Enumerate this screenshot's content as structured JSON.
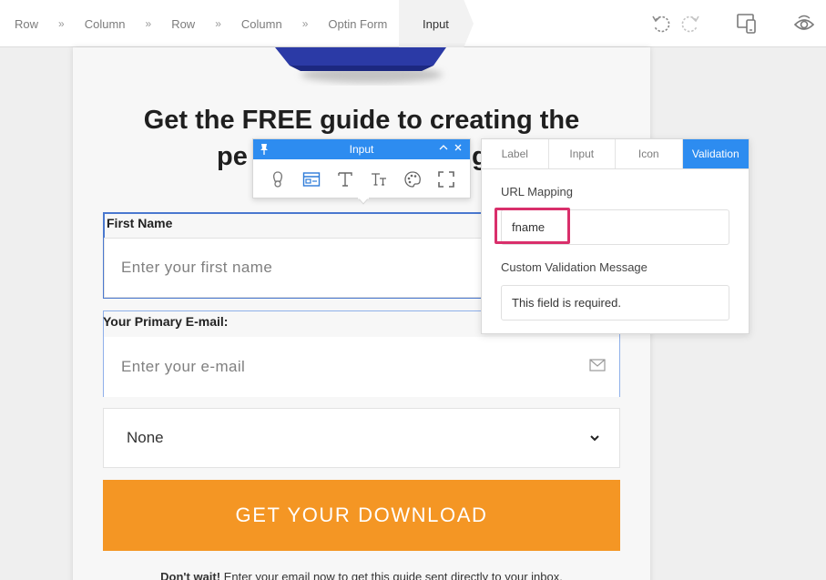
{
  "breadcrumb": {
    "items": [
      "Row",
      "Column",
      "Row",
      "Column",
      "Optin Form"
    ],
    "separator": "»",
    "active": "Input"
  },
  "toolbar_icons": [
    "undo-icon",
    "redo-icon",
    "responsive-preview-icon",
    "eye-icon"
  ],
  "page": {
    "headline_line1": "Get the FREE guide to creating the",
    "headline_line2_left": "pe",
    "headline_line2_right": "g",
    "first_name": {
      "label": "First Name",
      "placeholder": "Enter your first name"
    },
    "email": {
      "label": "Your Primary E-mail:",
      "placeholder": "Enter your e-mail"
    },
    "select": {
      "value": "None"
    },
    "cta_label": "GET YOUR DOWNLOAD",
    "footer_bold": "Don't wait!",
    "footer_text": " Enter your email now to get this guide sent directly to your inbox."
  },
  "mini_toolbar": {
    "title": "Input",
    "tools": [
      "pin-tool-icon",
      "input-field-icon",
      "text-style-icon",
      "font-size-icon",
      "palette-icon",
      "expand-icon"
    ]
  },
  "panel": {
    "tabs": [
      {
        "label": "Label",
        "active": false
      },
      {
        "label": "Input",
        "active": false
      },
      {
        "label": "Icon",
        "active": false
      },
      {
        "label": "Validation",
        "active": true
      }
    ],
    "url_mapping_label": "URL Mapping",
    "url_mapping_value": "fname",
    "validation_label": "Custom Validation Message",
    "validation_value": "This field is required."
  },
  "colors": {
    "accent_blue": "#2d8cf0",
    "cta_orange": "#f49624",
    "highlight_pink": "#d92f6b",
    "selection_blue": "#4a78cf"
  }
}
